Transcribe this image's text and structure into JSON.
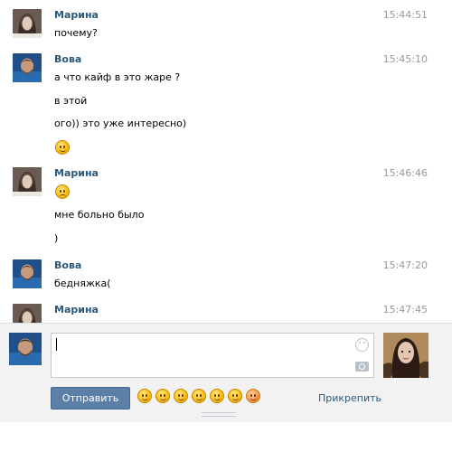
{
  "messages": [
    {
      "author": "Марина",
      "time": "15:44:51",
      "avatar": "marina-avatar-icon",
      "lines": [
        "почему?"
      ]
    },
    {
      "author": "Вова",
      "time": "15:45:10",
      "avatar": "vova-avatar-icon",
      "lines": [
        "а что кайф в это жаре ?",
        "в этой",
        "ого)) это уже интересно)"
      ],
      "emoji": "smile-emoji-icon"
    },
    {
      "author": "Марина",
      "time": "15:46:46",
      "avatar": "marina-avatar-icon",
      "emoji_first": "eye-roll-emoji-icon",
      "lines": [
        "мне больно было",
        ")"
      ]
    },
    {
      "author": "Вова",
      "time": "15:47:20",
      "avatar": "vova-avatar-icon",
      "lines": [
        "бедняжка("
      ]
    },
    {
      "author": "Марина",
      "time": "15:47:45",
      "avatar": "marina-avatar-icon",
      "lines": []
    }
  ],
  "composer": {
    "send_label": "Отправить",
    "attach_label": "Прикрепить",
    "emoji_bar": [
      "laughing-emoji-icon",
      "smile-emoji-icon",
      "confused-emoji-icon",
      "angry-emoji-icon",
      "wink-emoji-icon",
      "shocked-emoji-icon",
      "kiss-emoji-icon"
    ]
  },
  "colors": {
    "author": "#2b587a",
    "time": "#999999",
    "send_button": "#5b7fa6",
    "composer_bg": "#f2f2f2"
  }
}
